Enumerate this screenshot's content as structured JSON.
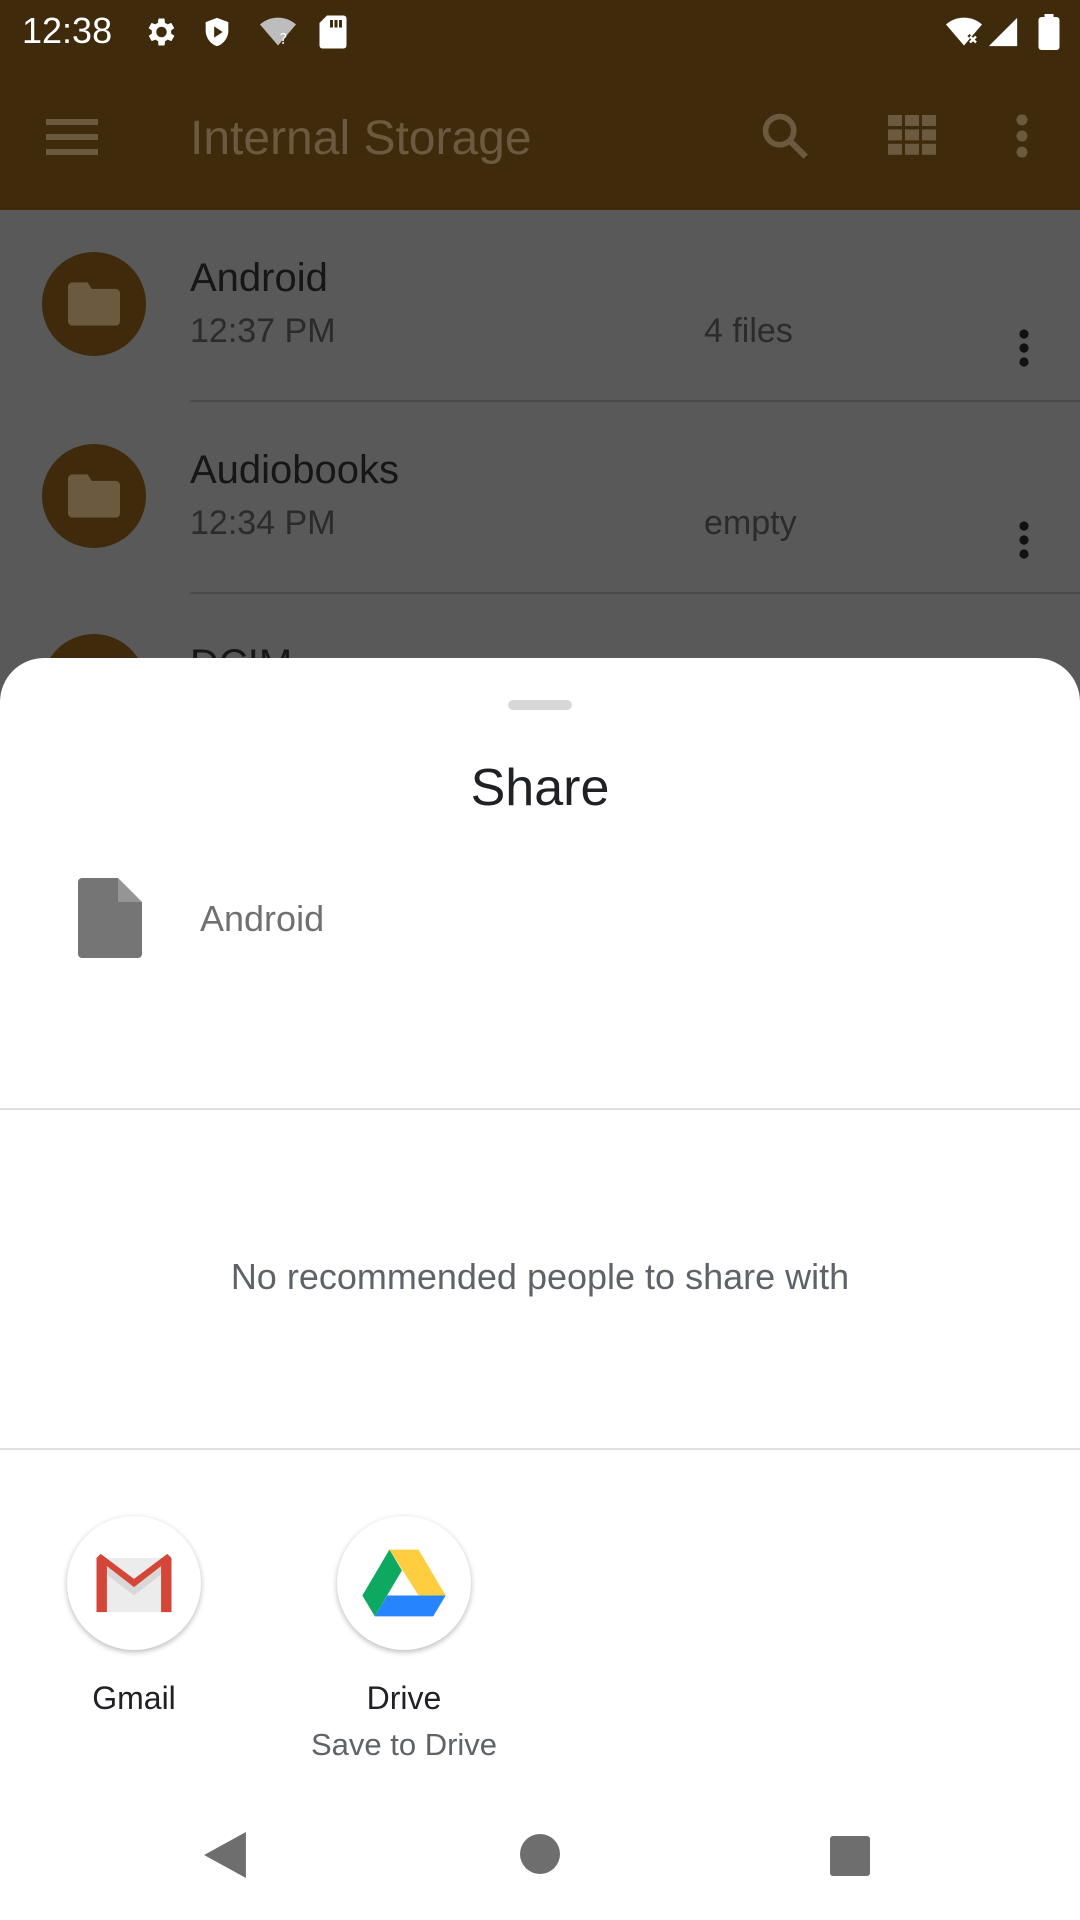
{
  "status_bar": {
    "time": "12:38",
    "icons": [
      "settings-icon",
      "shield-icon",
      "wifi-question-icon",
      "sd-card-icon",
      "wifi-x-icon",
      "signal-icon",
      "battery-icon"
    ]
  },
  "app_bar": {
    "title": "Internal Storage",
    "icons": [
      "menu-icon",
      "search-icon",
      "grid-view-icon",
      "more-vert-icon"
    ]
  },
  "file_list": [
    {
      "name": "Android",
      "date": "12:37 PM",
      "info": "4 files"
    },
    {
      "name": "Audiobooks",
      "date": "12:34 PM",
      "info": "empty"
    },
    {
      "name": "DCIM",
      "date": "",
      "info": ""
    }
  ],
  "share_sheet": {
    "title": "Share",
    "file_name": "Android",
    "empty_message": "No recommended people to share with",
    "targets": [
      {
        "name": "Gmail",
        "subtitle": ""
      },
      {
        "name": "Drive",
        "subtitle": "Save to Drive"
      }
    ]
  },
  "nav_bar": {
    "buttons": [
      "back-icon",
      "home-icon",
      "recents-icon"
    ]
  },
  "colors": {
    "app_bar_dimmed": "#3f2a0b",
    "scrim": "#595959",
    "sheet_bg": "#ffffff"
  }
}
